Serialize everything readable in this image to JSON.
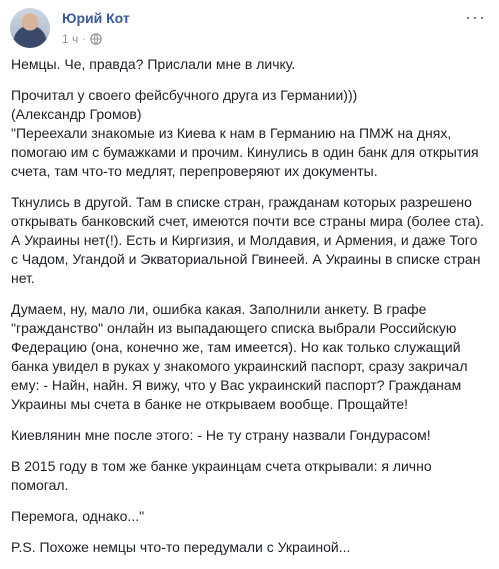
{
  "post": {
    "author": "Юрий Кот",
    "time": "1 ч",
    "paragraphs": [
      {
        "lines": [
          "Немцы. Че, правда? Прислали мне в личку."
        ]
      },
      {
        "lines": [
          "Прочитал у своего фейсбучного друга из Германии)))",
          "(Александр Громов)",
          "\"Переехали знакомые из Киева к нам в Германию на ПМЖ на днях,",
          "помогаю им с бумажками и прочим. Кинулись в один банк для открытия",
          "счета, там что-то медлят, перепроверяют их документы."
        ]
      },
      {
        "lines": [
          "Ткнулись в другой. Там в списке стран, гражданам которых разрешено",
          "открывать банковский счет, имеются почти все страны мира (более ста).",
          "А Украины нет(!). Есть и Киргизия, и Молдавия, и Армения, и даже Того",
          "с Чадом, Угандой и Экваториальной Гвинеей. А Украины в списке стран",
          "нет."
        ]
      },
      {
        "lines": [
          "Думаем, ну, мало ли, ошибка какая. Заполнили анкету. В графе",
          "\"гражданство\" онлайн из выпадающего списка выбрали Российскую",
          "Федерацию (она, конечно же, там имеется). Но как только служащий",
          "банка увидел в руках у знакомого украинский паспорт, сразу закричал",
          "ему: - Найн, найн. Я вижу, что у Вас украинский паспорт? Гражданам",
          "Украины мы счета в банке не открываем вообще. Прощайте!"
        ]
      },
      {
        "lines": [
          "Киевлянин мне после этого: - Не ту страну назвали Гондурасом!"
        ]
      },
      {
        "lines": [
          "В 2015 году в том же банке украинцам счета открывали: я лично",
          "помогал."
        ]
      },
      {
        "lines": [
          "Перемога, однако...\""
        ]
      },
      {
        "lines": [
          "P.S. Похоже немцы что-то передумали с Украиной..."
        ]
      }
    ]
  }
}
